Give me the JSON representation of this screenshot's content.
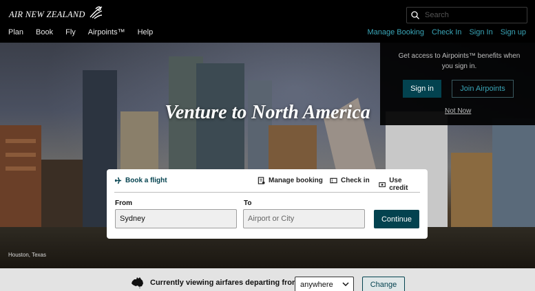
{
  "brand": {
    "name": "AIR NEW ZEALAND",
    "logo_icon": "koru-icon"
  },
  "search": {
    "placeholder": "Search",
    "icon": "search-icon"
  },
  "nav": {
    "left": [
      "Plan",
      "Book",
      "Fly",
      "Airpoints™",
      "Help"
    ],
    "right": [
      "Manage Booking",
      "Check In",
      "Sign In",
      "Sign up"
    ]
  },
  "hero": {
    "title": "Venture to North America",
    "caption": "Houston, Texas"
  },
  "signin_panel": {
    "text": "Get access to Airpoints™ benefits when you sign in.",
    "signin_label": "Sign in",
    "join_label": "Join Airpoints",
    "not_now_label": "Not Now"
  },
  "booking": {
    "tabs": [
      {
        "label": "Book a flight",
        "icon": "plane-icon",
        "active": true
      },
      {
        "label": "Manage booking",
        "icon": "document-icon",
        "active": false
      },
      {
        "label": "Check in",
        "icon": "ticket-icon",
        "active": false
      },
      {
        "label": "Use credit",
        "icon": "credit-icon",
        "active": false
      }
    ],
    "from_label": "From",
    "from_value": "Sydney",
    "to_label": "To",
    "to_placeholder": "Airport or City",
    "continue_label": "Continue"
  },
  "region_bar": {
    "text": "Currently viewing airfares departing from",
    "selected": "anywhere",
    "change_label": "Change",
    "icon": "australia-map-icon"
  },
  "colors": {
    "accent": "#03424f",
    "link": "#3aa6b8"
  }
}
